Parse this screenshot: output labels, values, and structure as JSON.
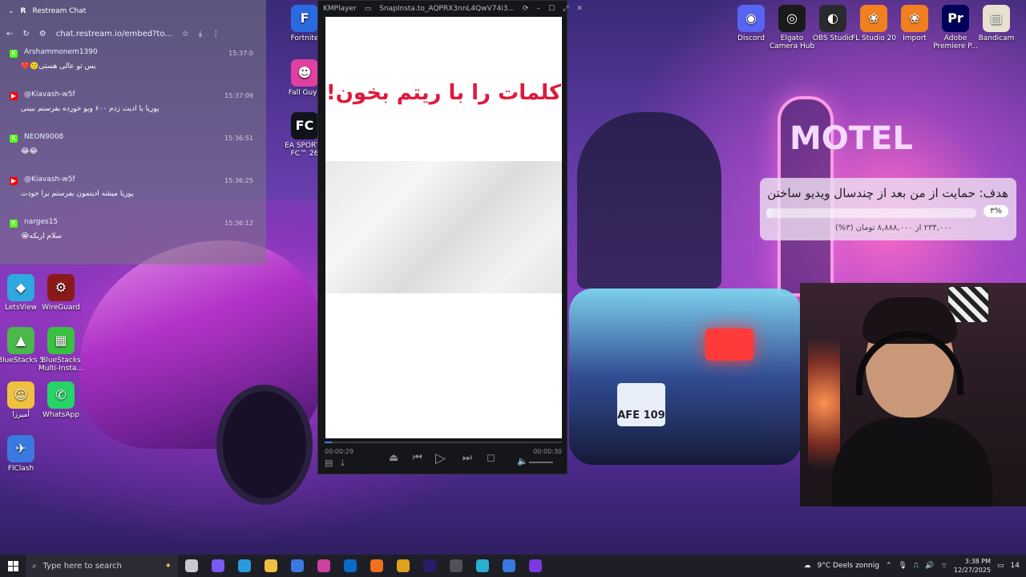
{
  "browser_chat": {
    "tab_title": "Restream Chat",
    "url": "chat.restream.io/embed?to...",
    "messages": [
      {
        "user": "Arshammonem1390",
        "time": "15:37:0",
        "text": "یس تو عالی هستی🙂❤️",
        "platform": "kick",
        "color": "#53fc18"
      },
      {
        "user": "@Kiavash-w5f",
        "time": "15:37:09",
        "text": "پوریا یا ادیت زدم ۶۰۰ ویو خورده بفرستم ببینی",
        "platform": "youtube",
        "color": "#ff0000"
      },
      {
        "user": "NEON9008",
        "time": "15:36:51",
        "text": "😂😂",
        "platform": "kick",
        "color": "#53fc18"
      },
      {
        "user": "@Kiavash-w5f",
        "time": "15:36:25",
        "text": "پوریا میشه ادیتمون بفرستم برا خودت",
        "platform": "youtube",
        "color": "#ff0000"
      },
      {
        "user": "narges15",
        "time": "15:36:12",
        "text": "سلام اریکه😭",
        "platform": "kick",
        "color": "#53fc18"
      }
    ]
  },
  "kmplayer": {
    "app_name": "KMPlayer",
    "file_title": "SnapInsta.to_AQPRX3nnL4QwV74i3...",
    "video_heading": "کلمات را با ریتم بخون!",
    "time_current": "00:00:29",
    "time_total": "00:00:30",
    "progress_fraction": 0.03
  },
  "desktop_icons_left": [
    {
      "label": "LetsView",
      "color": "#2fa8e0",
      "glyph": "◆"
    },
    {
      "label": "WireGuard",
      "color": "#8a1a1a",
      "glyph": "⚙"
    },
    {
      "label": "BlueStacks 5",
      "color": "#4ab84a",
      "glyph": "▲"
    },
    {
      "label": "BlueStacks Multi-Insta...",
      "color": "#3ac040",
      "glyph": "▦"
    },
    {
      "label": "آمیرزا",
      "color": "#f0c040",
      "glyph": "☺"
    },
    {
      "label": "WhatsApp",
      "color": "#25d366",
      "glyph": "✆"
    },
    {
      "label": "FlClash",
      "color": "#3a7ae0",
      "glyph": "✈"
    }
  ],
  "desktop_icons_col2": [
    {
      "label": "Fortnite",
      "color": "#2a6ae0",
      "glyph": "F"
    },
    {
      "label": "Fall Guys",
      "color": "#e040a0",
      "glyph": "☻"
    },
    {
      "label": "EA SPORTS FC™ 26",
      "color": "#101418",
      "glyph": "FC"
    }
  ],
  "desktop_icons_top": [
    {
      "label": "Discord",
      "color": "#5865f2",
      "glyph": "◉"
    },
    {
      "label": "Elgato Camera Hub",
      "color": "#1a1a1a",
      "glyph": "◎"
    },
    {
      "label": "OBS Studio",
      "color": "#2a2a2e",
      "glyph": "◐"
    },
    {
      "label": "FL Studio 20",
      "color": "#f08020",
      "glyph": "❀"
    },
    {
      "label": "Import",
      "color": "#f08020",
      "glyph": "❀"
    },
    {
      "label": "Adobe Premiere P...",
      "color": "#00005b",
      "glyph": "Pr"
    },
    {
      "label": "Bandicam",
      "color": "#e8e0d0",
      "glyph": "▤"
    }
  ],
  "goal_widget": {
    "title": "هدف: حمایت از من بعد از چندسال ویدیو ساختن",
    "percent_label": "۳%",
    "subtitle": "۲۳۴,۰۰۰ از ۸,۸۸۸,۰۰۰ تومان (۳%)",
    "progress_fraction": 0.03
  },
  "car_plate": "AFE 109",
  "motel_sign": "MOTEL",
  "taskbar": {
    "search_placeholder": "Type here to search",
    "weather": "9°C  Deels zonnig",
    "time": "3:38 PM",
    "date": "12/27/2025",
    "notifications": "14",
    "apps": [
      {
        "name": "task-view",
        "color": "#c8c8d0"
      },
      {
        "name": "copilot",
        "color": "#7a5af0"
      },
      {
        "name": "edge",
        "color": "#2a9ae0"
      },
      {
        "name": "file-explorer",
        "color": "#f0c040"
      },
      {
        "name": "store",
        "color": "#3a7ae0"
      },
      {
        "name": "instagram",
        "color": "#d040a0"
      },
      {
        "name": "outlook",
        "color": "#0a6ac8"
      },
      {
        "name": "firefox",
        "color": "#f07020"
      },
      {
        "name": "chrome",
        "color": "#e0a020"
      },
      {
        "name": "premiere",
        "color": "#2a1a6a"
      },
      {
        "name": "obs",
        "color": "#505058"
      },
      {
        "name": "edge-beta",
        "color": "#2ab0d0"
      },
      {
        "name": "flclash",
        "color": "#3a7ae0"
      },
      {
        "name": "kmplayer",
        "color": "#7a3ae0"
      }
    ]
  }
}
